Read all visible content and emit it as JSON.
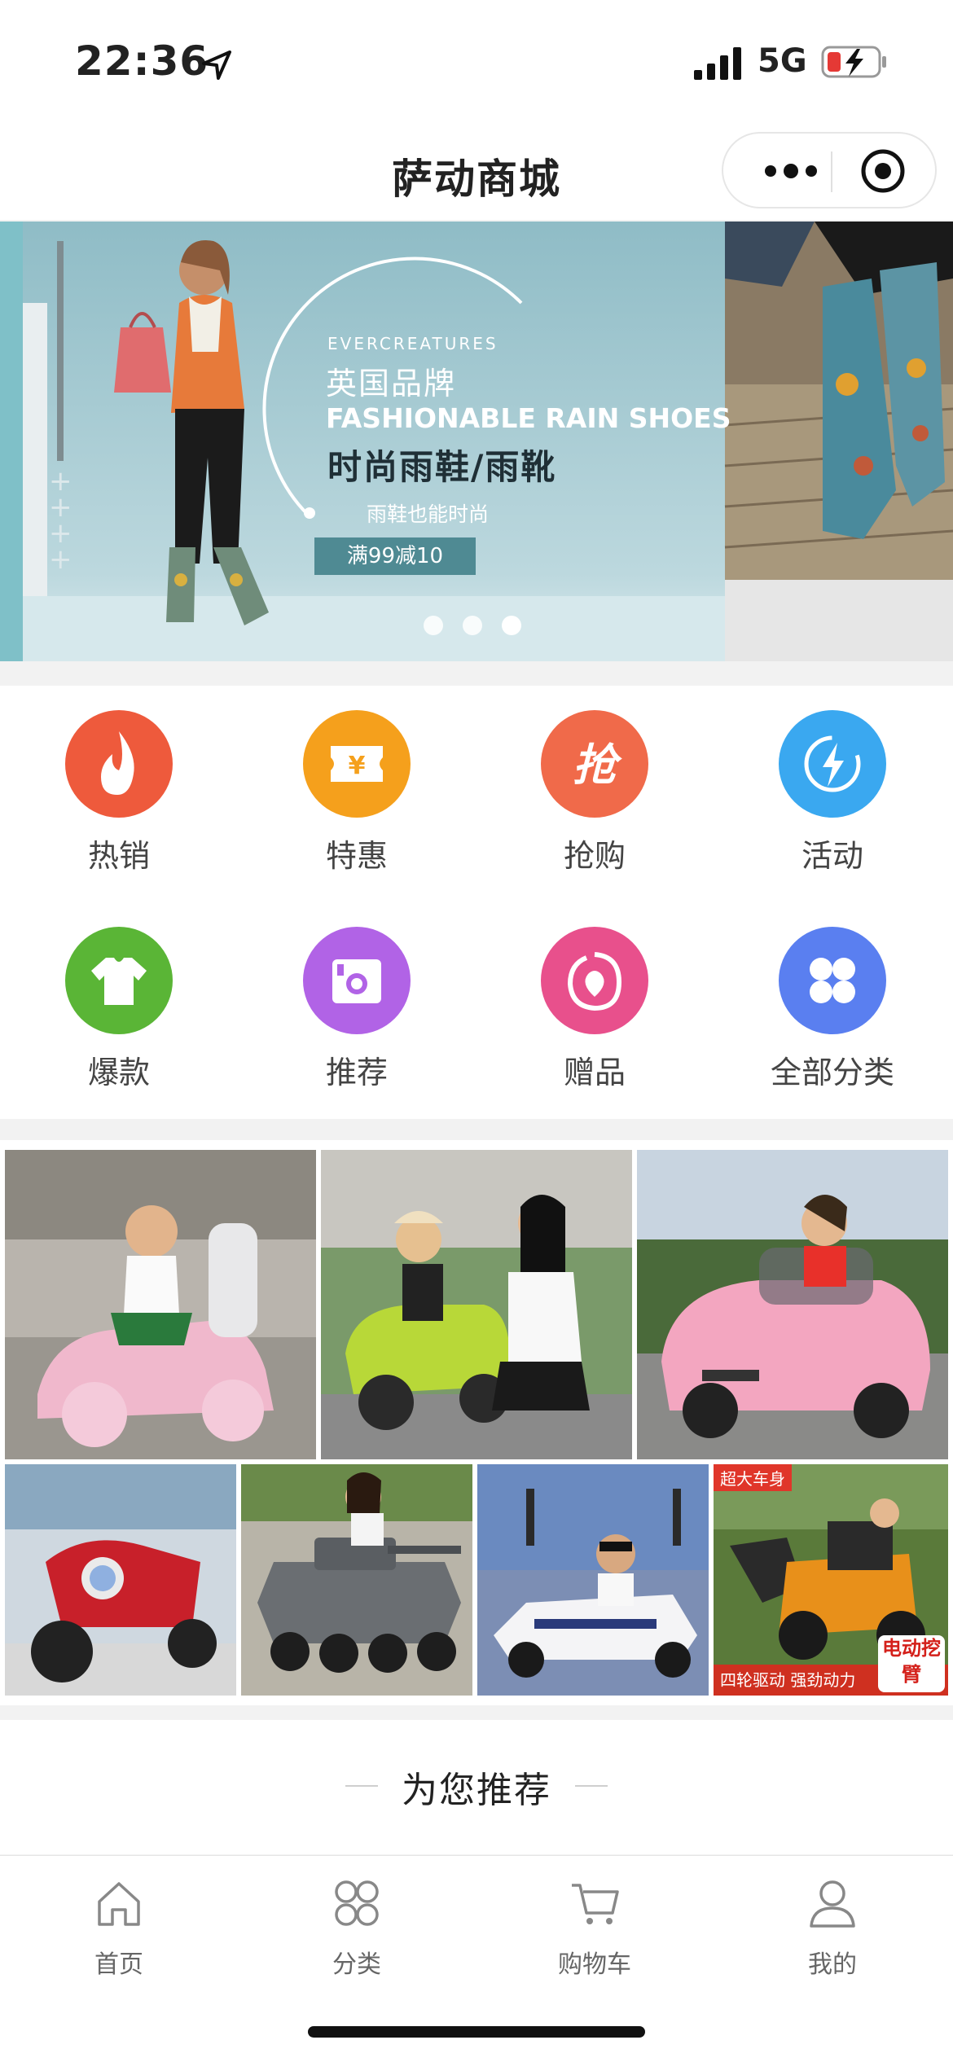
{
  "status_bar": {
    "time": "22:36",
    "network": "5G"
  },
  "header": {
    "title": "萨动商城"
  },
  "banner": {
    "brand": "EVERCREATURES",
    "subtitle_cn": "英国品牌",
    "subtitle_en": "FASHIONABLE RAIN SHOES",
    "headline": "时尚雨鞋/雨靴",
    "tagline": "雨鞋也能时尚",
    "promo": "满99减10"
  },
  "categories": [
    {
      "label": "热销",
      "icon": "fire-icon",
      "color": "#ee5a3c"
    },
    {
      "label": "特惠",
      "icon": "ticket-icon",
      "color": "#f5a01c"
    },
    {
      "label": "抢购",
      "icon": "grab-icon",
      "color": "#f06a4a"
    },
    {
      "label": "活动",
      "icon": "lightning-icon",
      "color": "#3aa8f0"
    },
    {
      "label": "爆款",
      "icon": "shirt-icon",
      "color": "#5ab536"
    },
    {
      "label": "推荐",
      "icon": "camera-icon",
      "color": "#b163e6"
    },
    {
      "label": "赠品",
      "icon": "gift-face-icon",
      "color": "#e8508c"
    },
    {
      "label": "全部分类",
      "icon": "grid-icon",
      "color": "#5a7ff0"
    }
  ],
  "products": {
    "tile_7_badge": "超大车身",
    "tile_7_footer": "四轮驱动 强劲动力",
    "tile_7_side": "电动挖臂"
  },
  "recommend": {
    "title": "为您推荐"
  },
  "tabbar": [
    {
      "label": "首页",
      "icon": "home-icon"
    },
    {
      "label": "分类",
      "icon": "category-icon"
    },
    {
      "label": "购物车",
      "icon": "cart-icon"
    },
    {
      "label": "我的",
      "icon": "user-icon"
    }
  ]
}
